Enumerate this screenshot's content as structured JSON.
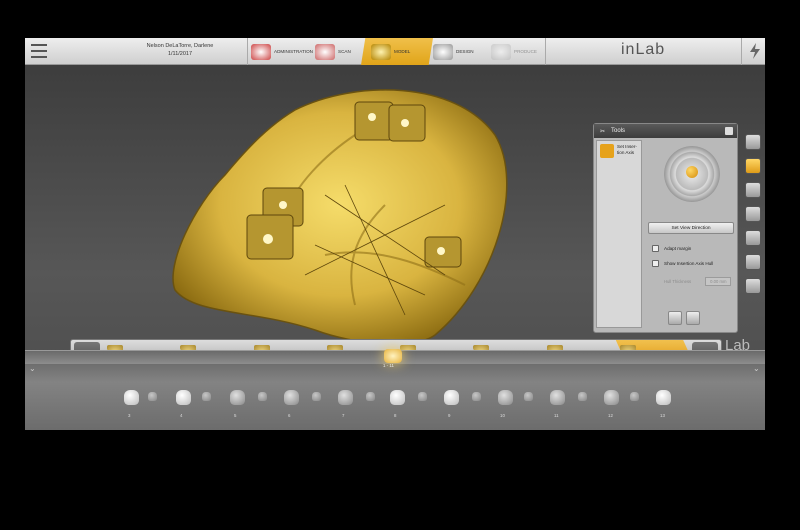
{
  "topbar": {
    "patient_name": "Nelson DeLaTorre, Darlene",
    "patient_date": "1/11/2017",
    "phases": [
      "ADMINISTRATION",
      "SCAN",
      "MODEL",
      "DESIGN",
      "PRODUCE"
    ],
    "active_phase": "MODEL",
    "brand": "inLab"
  },
  "tools_panel": {
    "title": "Tools",
    "tool_item": "Set Inser-tion Axis",
    "set_view_button": "Set View Direction",
    "options": [
      "Adapt margin",
      "Show Insertion Axis Hull"
    ],
    "param_label": "Hull Thickness",
    "param_value": "0.00 mm"
  },
  "steps": [
    {
      "label": "Edit Model",
      "active": false
    },
    {
      "label": "Manual correlation",
      "active": false
    },
    {
      "label": "Check Occlusion",
      "active": false
    },
    {
      "label": "Set Model Axis",
      "active": false
    },
    {
      "label": "Set Jaw Line",
      "active": false
    },
    {
      "label": "Trim Model",
      "active": false
    },
    {
      "label": "Draw Margin",
      "active": false
    },
    {
      "label": "Set Insertion Axis",
      "active": true
    }
  ],
  "lab_mark": "Lab",
  "jaw_label": "1 - 11",
  "tooth_numbers": [
    "3",
    "4",
    "5",
    "6",
    "7",
    "8",
    "9",
    "10",
    "11",
    "12",
    "13"
  ],
  "colors": {
    "accent": "#e3a21a",
    "model": "#d9b440"
  }
}
